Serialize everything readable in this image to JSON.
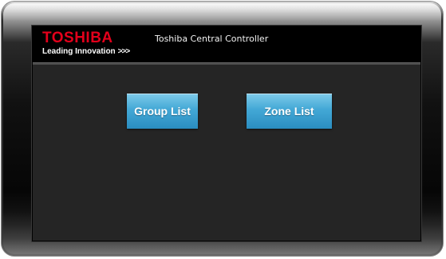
{
  "header": {
    "logo_text": "TOSHIBA",
    "tagline": "Leading Innovation",
    "tagline_arrows": ">>>",
    "title": "Toshiba Central Controller"
  },
  "main": {
    "buttons": [
      {
        "label": "Group List"
      },
      {
        "label": "Zone List"
      }
    ]
  },
  "colors": {
    "brand_red": "#e3001b",
    "button_blue": "#43a8d6",
    "screen_background": "#252525",
    "header_background": "#000000"
  }
}
